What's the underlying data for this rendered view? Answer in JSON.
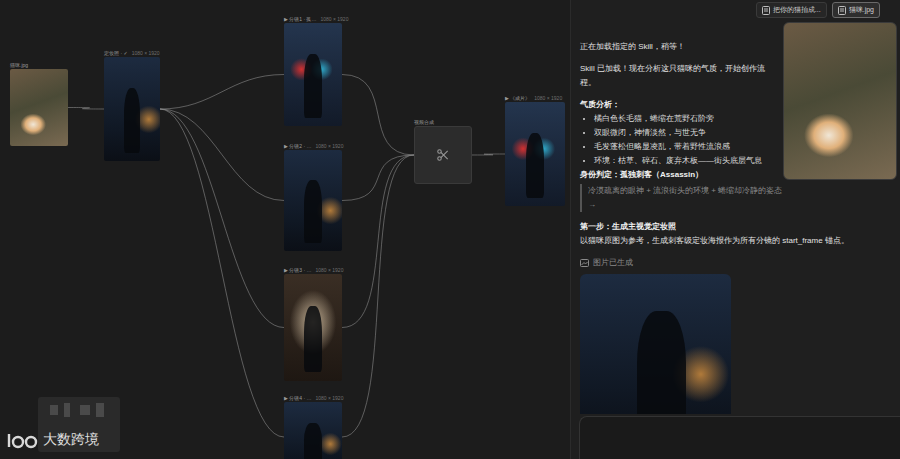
{
  "canvas": {
    "nodes": [
      {
        "kind": "image",
        "tone": "photo",
        "label": "猫咪.jpg",
        "meta": ""
      },
      {
        "kind": "image",
        "tone": "dark",
        "label": "定妆照 · ✓",
        "meta": "1080 × 1920"
      },
      {
        "kind": "image",
        "tone": "neon",
        "label": "▶ 分镜1 · 孤…",
        "meta": "1080 × 1920"
      },
      {
        "kind": "image",
        "tone": "dark",
        "label": "▶ 分镜2 · …",
        "meta": "1080 × 1920"
      },
      {
        "kind": "image",
        "tone": "warm",
        "label": "▶ 分镜3 · …",
        "meta": "1080 × 1920"
      },
      {
        "kind": "image",
        "tone": "dark",
        "label": "▶ 分镜4 · …",
        "meta": "1080 × 1920"
      },
      {
        "kind": "tool",
        "tone": "tool",
        "label": "视频合成",
        "meta": ""
      },
      {
        "kind": "image",
        "tone": "neon",
        "label": "▶ 《成片》",
        "meta": "1080 × 1920"
      }
    ],
    "edges": [
      [
        0,
        1
      ],
      [
        1,
        2
      ],
      [
        1,
        3
      ],
      [
        1,
        4
      ],
      [
        1,
        5
      ],
      [
        2,
        6
      ],
      [
        3,
        6
      ],
      [
        4,
        6
      ],
      [
        5,
        6
      ],
      [
        6,
        7
      ]
    ]
  },
  "watermark": "大数跨境",
  "chat": {
    "attachments": [
      {
        "label": "把你的猫拍成...",
        "selected": false
      },
      {
        "label": "猫咪.jpg",
        "selected": true
      }
    ],
    "preview": {
      "open": true
    },
    "blocks": [
      {
        "kind": "text",
        "text": "正在加载指定的 Skill，稍等！"
      },
      {
        "kind": "text",
        "text": "Skill 已加载！现在分析这只猫咪的气质，开始创作流程。"
      },
      {
        "kind": "heading",
        "text": "气质分析："
      },
      {
        "kind": "bullets",
        "items": [
          "橘白色长毛猫，蜷缩在荒野石阶旁",
          "双眼微闭，神情淡然，与世无争",
          "毛发蓬松但略显凌乱，带着野性流浪感",
          "环境：枯草、碎石、废弃木板——街头底层气息"
        ]
      },
      {
        "kind": "heading",
        "text": "身份判定：孤独刺客（Assassin）"
      },
      {
        "kind": "quote",
        "text": "冷漠疏离的眼神 + 流浪街头的环境 + 蜷缩却冷静的姿态 →"
      },
      {
        "kind": "heading",
        "text": "第一步：生成主视觉定妆照"
      },
      {
        "kind": "text",
        "text": "以猫咪原图为参考，生成刺客级定妆海报作为所有分镜的 start_frame 锚点。"
      },
      {
        "kind": "status",
        "text": "图片已生成"
      },
      {
        "kind": "image"
      }
    ]
  }
}
